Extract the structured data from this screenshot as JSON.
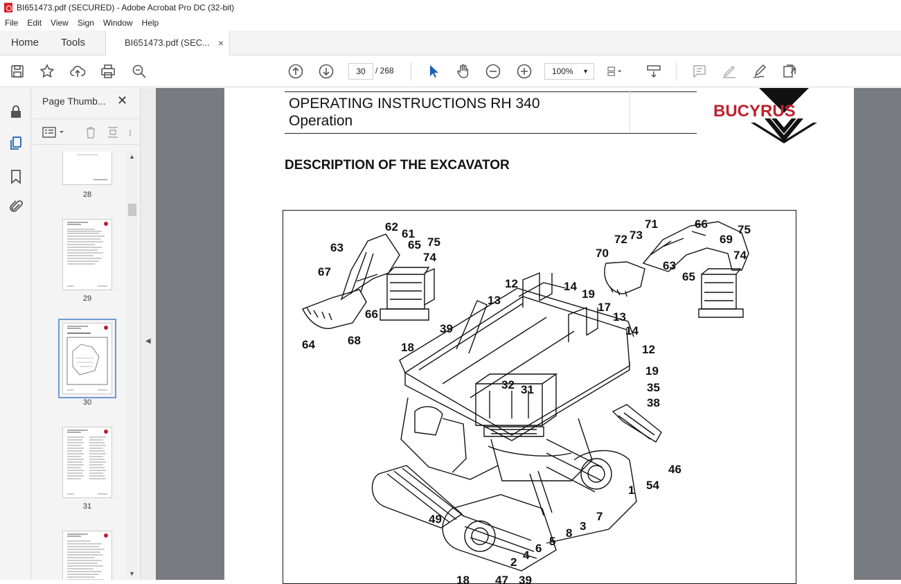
{
  "window": {
    "title": "BI651473.pdf (SECURED) - Adobe Acrobat Pro DC (32-bit)"
  },
  "menu": [
    "File",
    "Edit",
    "View",
    "Sign",
    "Window",
    "Help"
  ],
  "tabs": {
    "home": "Home",
    "tools": "Tools",
    "document": "BI651473.pdf (SEC...",
    "close": "×"
  },
  "toolbar": {
    "page_current": "30",
    "page_total": "/  268",
    "zoom": "100%",
    "icons": [
      "save-icon",
      "bookmark-star-icon",
      "upload-icon",
      "print-icon",
      "search-zoom-icon",
      "page-up-icon",
      "page-down-icon",
      "select-arrow-icon",
      "hand-icon",
      "zoom-out-icon",
      "zoom-in-icon",
      "fit-page-icon",
      "scroll-mode-icon",
      "comment-icon",
      "highlight-icon",
      "sign-icon",
      "send-icon"
    ]
  },
  "panel": {
    "title": "Page Thumb...",
    "close": "✕",
    "thumbnails": [
      {
        "label": "28"
      },
      {
        "label": "29"
      },
      {
        "label": "30",
        "selected": true
      },
      {
        "label": "31"
      },
      {
        "label": ""
      }
    ]
  },
  "document": {
    "header_line1": "OPERATING INSTRUCTIONS RH 340",
    "header_line2": "Operation",
    "logo": "BUCYRUS",
    "heading": "DESCRIPTION OF THE EXCAVATOR",
    "callouts": [
      "62",
      "61",
      "65",
      "75",
      "63",
      "74",
      "67",
      "66",
      "68",
      "64",
      "71",
      "66",
      "72",
      "73",
      "75",
      "69",
      "70",
      "74",
      "63",
      "65",
      "12",
      "14",
      "19",
      "13",
      "17",
      "13",
      "14",
      "39",
      "12",
      "18",
      "19",
      "32",
      "31",
      "35",
      "38",
      "46",
      "54",
      "1",
      "7",
      "49",
      "3",
      "8",
      "5",
      "6",
      "4",
      "2",
      "18",
      "47",
      "39"
    ]
  },
  "colors": {
    "logo_red": "#c0202c",
    "viewer_bg": "#777b80",
    "selection": "#6d99d4"
  }
}
